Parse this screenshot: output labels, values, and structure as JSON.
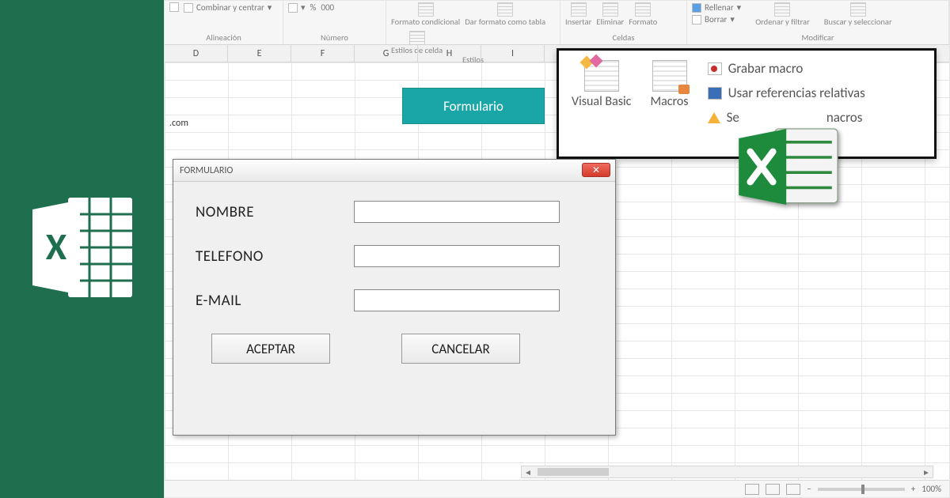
{
  "left": {
    "brand": "Excel"
  },
  "ribbon": {
    "alignment": {
      "label": "Alineación",
      "merge": "Combinar y centrar"
    },
    "number": {
      "label": "Número",
      "percent": "%",
      "thousands": "000"
    },
    "styles": {
      "label": "Estilos",
      "conditional": "Formato condicional",
      "table": "Dar formato como tabla",
      "cellstyles": "Estilos de celda"
    },
    "cells": {
      "label": "Celdas",
      "insert": "Insertar",
      "delete": "Eliminar",
      "format": "Formato"
    },
    "editing": {
      "label": "Modificar",
      "fill": "Rellenar",
      "clear": "Borrar",
      "sort": "Ordenar y filtrar",
      "find": "Buscar y seleccionar"
    }
  },
  "columns": [
    "D",
    "E",
    "F",
    "G",
    "H",
    "I"
  ],
  "cellA": ".com",
  "formButton": "Formulario",
  "dialog": {
    "title": "FORMULARIO",
    "fields": {
      "name": "NOMBRE",
      "phone": "TELEFONO",
      "email": "E-MAIL"
    },
    "accept": "ACEPTAR",
    "cancel": "CANCELAR"
  },
  "developer": {
    "vb": "Visual Basic",
    "macros": "Macros",
    "record": "Grabar macro",
    "relative": "Usar referencias relativas",
    "security_pre": "Se",
    "security_post": "nacros"
  },
  "status": {
    "zoom": "100%",
    "minus": "−",
    "plus": "+"
  }
}
